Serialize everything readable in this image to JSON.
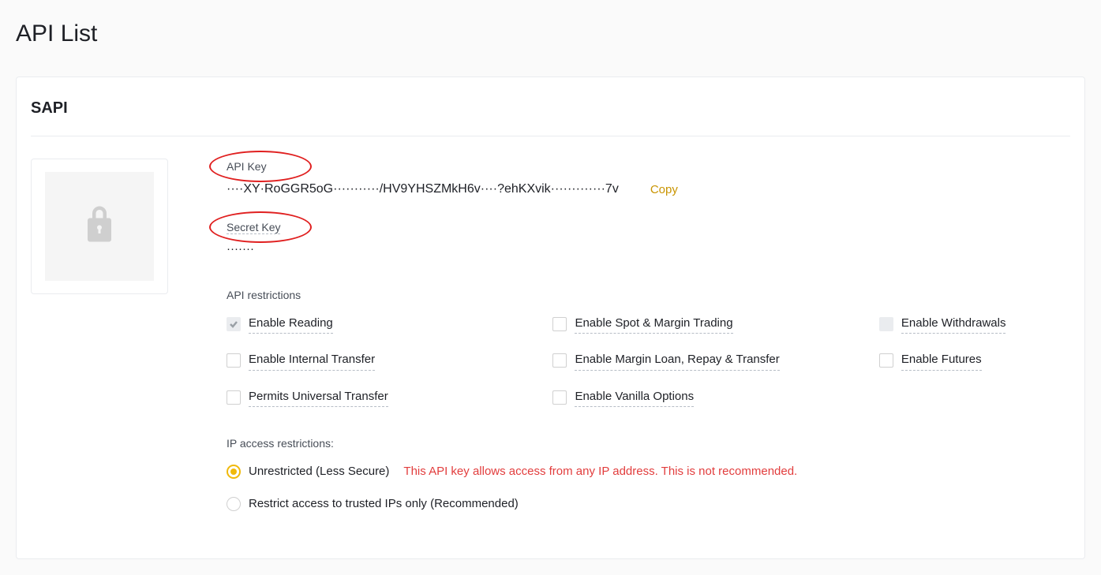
{
  "page": {
    "title": "API List"
  },
  "card": {
    "name": "SAPI"
  },
  "keys": {
    "api_key_label": "API Key",
    "api_key_value": "····XY·RoGGR5oG···········/HV9YHSZMkH6v····?ehKXvik·············7v",
    "copy_label": "Copy",
    "secret_key_label": "Secret Key",
    "secret_value": "·······"
  },
  "restrictions": {
    "label": "API restrictions",
    "items": [
      {
        "label": "Enable Reading",
        "checked": true,
        "locked": true
      },
      {
        "label": "Enable Spot & Margin Trading",
        "checked": false,
        "locked": false
      },
      {
        "label": "Enable Withdrawals",
        "checked": false,
        "locked": true
      },
      {
        "label": "Enable Internal Transfer",
        "checked": false,
        "locked": false
      },
      {
        "label": "Enable Margin Loan, Repay & Transfer",
        "checked": false,
        "locked": false
      },
      {
        "label": "Enable Futures",
        "checked": false,
        "locked": false
      },
      {
        "label": "Permits Universal Transfer",
        "checked": false,
        "locked": false
      },
      {
        "label": "Enable Vanilla Options",
        "checked": false,
        "locked": false
      }
    ]
  },
  "ip": {
    "label": "IP access restrictions:",
    "options": [
      {
        "label": "Unrestricted (Less Secure)",
        "selected": true,
        "warning": "This API key allows access from any IP address. This is not recommended."
      },
      {
        "label": "Restrict access to trusted IPs only (Recommended)",
        "selected": false,
        "warning": ""
      }
    ]
  }
}
